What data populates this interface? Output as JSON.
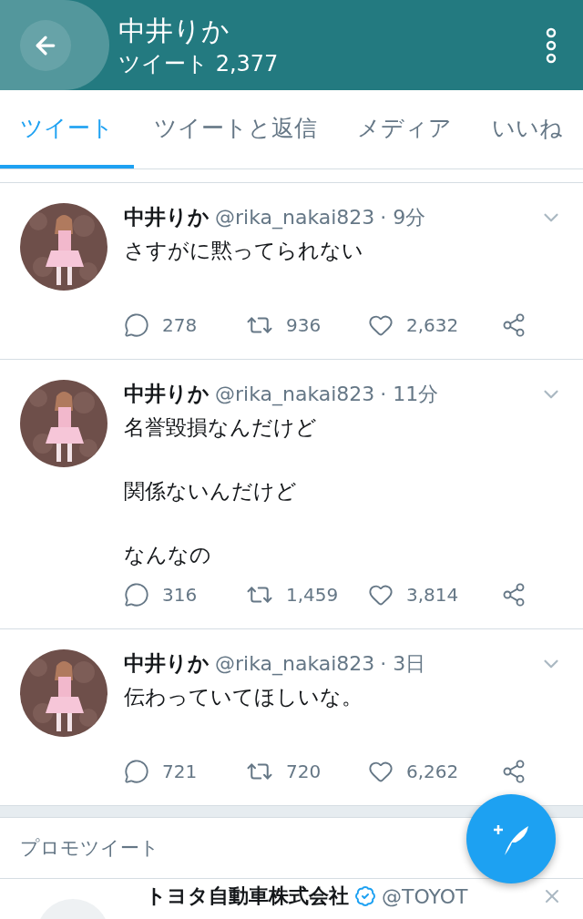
{
  "header": {
    "title": "中井りか",
    "subtitle": "ツイート 2,377"
  },
  "tabs": [
    {
      "label": "ツイート",
      "selected": true
    },
    {
      "label": "ツイートと返信",
      "selected": false
    },
    {
      "label": "メディア",
      "selected": false
    },
    {
      "label": "いいね",
      "selected": false
    }
  ],
  "tweets": [
    {
      "name": "中井りか",
      "handle": "@rika_nakai823",
      "time": "· 9分",
      "lines": [
        "さすがに黙ってられない"
      ],
      "replies": "278",
      "retweets": "936",
      "likes": "2,632"
    },
    {
      "name": "中井りか",
      "handle": "@rika_nakai823",
      "time": "· 11分",
      "lines": [
        "名誉毀損なんだけど",
        "関係ないんだけど",
        "なんなの"
      ],
      "replies": "316",
      "retweets": "1,459",
      "likes": "3,814"
    },
    {
      "name": "中井りか",
      "handle": "@rika_nakai823",
      "time": "· 3日",
      "lines": [
        "伝わっていてほしいな。"
      ],
      "replies": "721",
      "retweets": "720",
      "likes": "6,262"
    }
  ],
  "promo": {
    "label": "プロモツイート",
    "name": "トヨタ自動車株式会社",
    "verified": true,
    "handle": "@TOYOT"
  }
}
